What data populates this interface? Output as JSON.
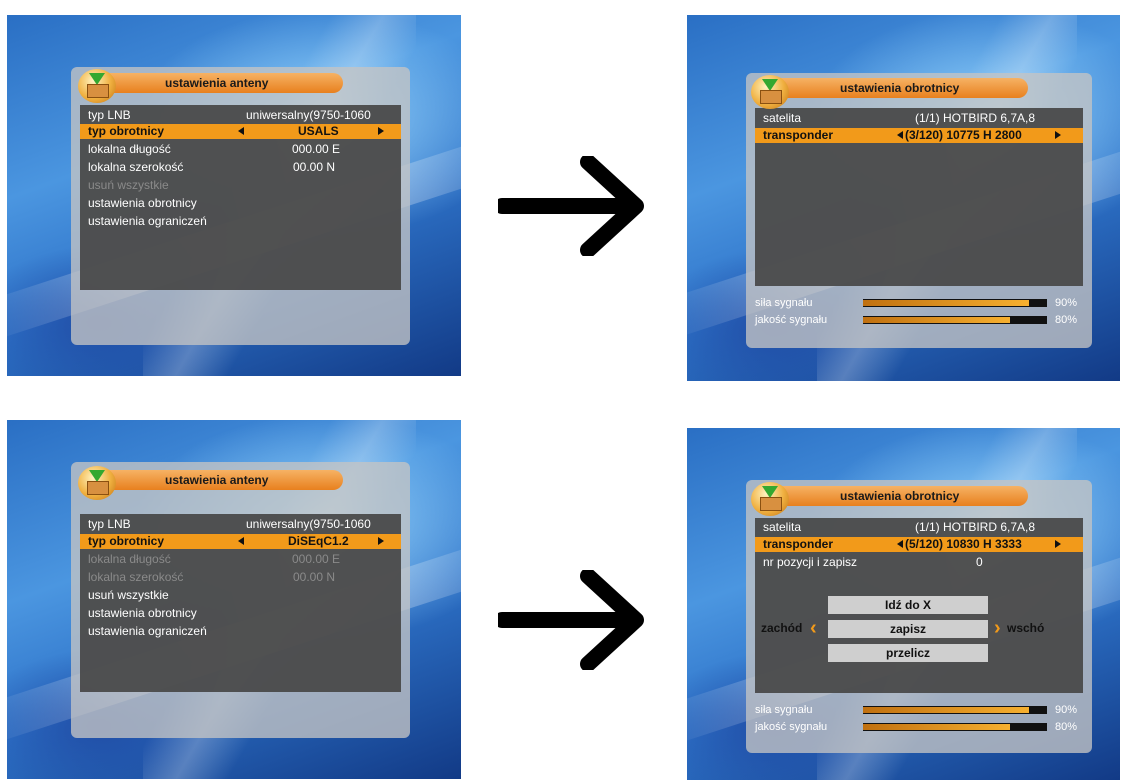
{
  "screen1": {
    "title": "ustawienia anteny",
    "rows": [
      {
        "label": "typ LNB",
        "value": "uniwersalny(9750-1060"
      },
      {
        "label": "typ obrotnicy",
        "value": "USALS"
      },
      {
        "label": "lokalna długość",
        "value": "000.00 E"
      },
      {
        "label": "lokalna szerokość",
        "value": "00.00 N"
      },
      {
        "label": "usuń wszystkie"
      },
      {
        "label": "ustawienia obrotnicy"
      },
      {
        "label": "ustawienia ograniczeń"
      }
    ]
  },
  "screen2": {
    "title": "ustawienia obrotnicy",
    "satelita_label": "satelita",
    "satelita_value": "(1/1) HOTBIRD 6,7A,8",
    "transponder_label": "transponder",
    "transponder_value": "(3/120) 10775 H 2800",
    "signal_strength_label": "siła sygnału",
    "signal_strength_pct": "90%",
    "signal_strength_fraction": 0.9,
    "signal_quality_label": "jakość sygnału",
    "signal_quality_pct": "80%",
    "signal_quality_fraction": 0.8
  },
  "screen3": {
    "title": "ustawienia anteny",
    "rows": [
      {
        "label": "typ LNB",
        "value": "uniwersalny(9750-1060"
      },
      {
        "label": "typ obrotnicy",
        "value": "DiSEqC1.2"
      },
      {
        "label": "lokalna długość",
        "value": "000.00 E"
      },
      {
        "label": "lokalna szerokość",
        "value": "00.00 N"
      },
      {
        "label": "usuń wszystkie"
      },
      {
        "label": "ustawienia obrotnicy"
      },
      {
        "label": "ustawienia ograniczeń"
      }
    ]
  },
  "screen4": {
    "title": "ustawienia obrotnicy",
    "satelita_label": "satelita",
    "satelita_value": "(1/1) HOTBIRD 6,7A,8",
    "transponder_label": "transponder",
    "transponder_value": "(5/120) 10830 H 3333",
    "position_label": "nr pozycji i zapisz",
    "position_value": "0",
    "goto_button": "Idź do X",
    "save_button": "zapisz",
    "calc_button": "przelicz",
    "west_label": "zachód",
    "east_label": "wschó",
    "signal_strength_label": "siła sygnału",
    "signal_strength_pct": "90%",
    "signal_strength_fraction": 0.9,
    "signal_quality_label": "jakość sygnału",
    "signal_quality_pct": "80%",
    "signal_quality_fraction": 0.8
  },
  "colors": {
    "accent": "#f29a1a",
    "panel_bg": "#464646",
    "frame": "#c4c4c4"
  },
  "icons": [
    "package-download-icon",
    "arrow-right-icon",
    "chevron-left-icon",
    "chevron-right-icon"
  ]
}
